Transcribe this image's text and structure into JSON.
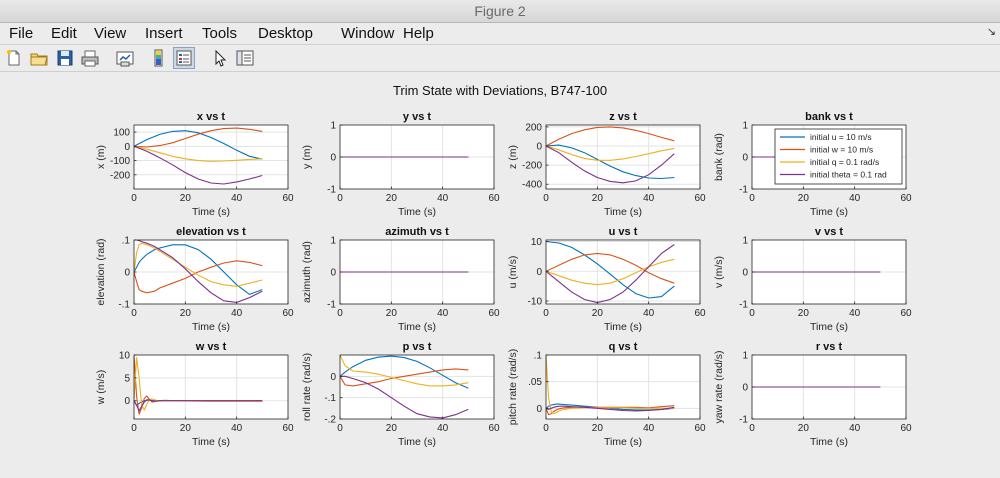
{
  "window": {
    "title": "Figure 2"
  },
  "menu": [
    "File",
    "Edit",
    "View",
    "Insert",
    "Tools",
    "Desktop",
    "Window",
    "Help"
  ],
  "toolbar": [
    {
      "name": "new-figure-icon"
    },
    {
      "name": "open-file-icon"
    },
    {
      "name": "save-icon"
    },
    {
      "name": "print-icon"
    },
    {
      "name": "link-plot-icon"
    },
    {
      "name": "colorbar-icon"
    },
    {
      "name": "legend-icon",
      "selected": true
    },
    {
      "name": "edit-plot-icon"
    },
    {
      "name": "plot-tools-icon"
    }
  ],
  "figure": {
    "suptitle": "Trim State with Deviations, B747-100"
  },
  "colors": {
    "u": "#0072BD",
    "w": "#D95319",
    "q": "#EDB120",
    "theta": "#7E2F8E",
    "bg": "#ececec",
    "axes": "#ffffff"
  },
  "legend": {
    "entries": [
      "initial u = 10 m/s",
      "initial w = 10 m/s",
      "initial q = 0.1 rad/s",
      "initial theta = 0.1 rad"
    ],
    "panel": "bank vs t",
    "placement": "top-right"
  },
  "chart_data": [
    {
      "type": "line",
      "title": "x vs t",
      "xlabel": "Time (s)",
      "ylabel": "x (m)",
      "xlim": [
        0,
        60
      ],
      "ylim": [
        -300,
        150
      ],
      "xticks": [
        0,
        20,
        40,
        60
      ],
      "yticks": [
        100,
        0,
        -100,
        -200
      ],
      "x": [
        0,
        5,
        10,
        15,
        20,
        25,
        30,
        35,
        40,
        45,
        50
      ],
      "series": [
        {
          "name": "initial u = 10 m/s",
          "values": [
            0,
            47,
            84,
            105,
            110,
            95,
            62,
            20,
            -28,
            -70,
            -90
          ]
        },
        {
          "name": "initial w = 10 m/s",
          "values": [
            0,
            -5,
            5,
            25,
            55,
            85,
            110,
            125,
            128,
            120,
            105
          ]
        },
        {
          "name": "initial q = 0.1 rad/s",
          "values": [
            0,
            -20,
            -45,
            -70,
            -88,
            -100,
            -105,
            -103,
            -98,
            -92,
            -88
          ]
        },
        {
          "name": "initial theta = 0.1 rad",
          "values": [
            0,
            -35,
            -80,
            -130,
            -185,
            -230,
            -258,
            -265,
            -250,
            -230,
            -205
          ]
        }
      ]
    },
    {
      "type": "line",
      "title": "y vs t",
      "xlabel": "Time (s)",
      "ylabel": "y (m)",
      "xlim": [
        0,
        60
      ],
      "ylim": [
        -1,
        1
      ],
      "xticks": [
        0,
        20,
        40,
        60
      ],
      "yticks": [
        1,
        0,
        -1
      ],
      "x": [
        0,
        50
      ],
      "series": [
        {
          "name": "initial u = 10 m/s",
          "values": [
            0,
            0
          ]
        },
        {
          "name": "initial w = 10 m/s",
          "values": [
            0,
            0
          ]
        },
        {
          "name": "initial q = 0.1 rad/s",
          "values": [
            0,
            0
          ]
        },
        {
          "name": "initial theta = 0.1 rad",
          "values": [
            0,
            0
          ]
        }
      ]
    },
    {
      "type": "line",
      "title": "z vs t",
      "xlabel": "Time (s)",
      "ylabel": "z (m)",
      "xlim": [
        0,
        60
      ],
      "ylim": [
        -450,
        220
      ],
      "xticks": [
        0,
        20,
        40,
        60
      ],
      "yticks": [
        200,
        0,
        -200,
        -400
      ],
      "x": [
        0,
        5,
        10,
        15,
        20,
        25,
        30,
        35,
        40,
        45,
        50
      ],
      "series": [
        {
          "name": "initial u = 10 m/s",
          "values": [
            0,
            10,
            -20,
            -70,
            -140,
            -210,
            -270,
            -310,
            -335,
            -340,
            -330
          ]
        },
        {
          "name": "initial w = 10 m/s",
          "values": [
            0,
            70,
            130,
            170,
            195,
            200,
            190,
            165,
            130,
            90,
            55
          ]
        },
        {
          "name": "initial q = 0.1 rad/s",
          "values": [
            0,
            -40,
            -90,
            -130,
            -150,
            -150,
            -135,
            -110,
            -80,
            -50,
            -25
          ]
        },
        {
          "name": "initial theta = 0.1 rad",
          "values": [
            0,
            -70,
            -170,
            -260,
            -330,
            -370,
            -385,
            -365,
            -300,
            -200,
            -80
          ]
        }
      ]
    },
    {
      "type": "line",
      "title": "bank vs t",
      "xlabel": "Time (s)",
      "ylabel": "bank (rad)",
      "xlim": [
        0,
        60
      ],
      "ylim": [
        -1,
        1
      ],
      "xticks": [
        0,
        20,
        40,
        60
      ],
      "yticks": [
        1,
        0,
        -1
      ],
      "x": [
        0,
        50
      ],
      "series": [
        {
          "name": "initial u = 10 m/s",
          "values": [
            0,
            0
          ]
        },
        {
          "name": "initial w = 10 m/s",
          "values": [
            0,
            0
          ]
        },
        {
          "name": "initial q = 0.1 rad/s",
          "values": [
            0,
            0
          ]
        },
        {
          "name": "initial theta = 0.1 rad",
          "values": [
            0,
            0
          ]
        }
      ]
    },
    {
      "type": "line",
      "title": "elevation vs t",
      "xlabel": "Time (s)",
      "ylabel": "elevation (rad)",
      "xlim": [
        0,
        60
      ],
      "ylim": [
        -0.1,
        0.1
      ],
      "xticks": [
        0,
        20,
        40,
        60
      ],
      "yticks": [
        0.1,
        0,
        -0.1
      ],
      "x": [
        0,
        1,
        2,
        3,
        5,
        8,
        10,
        15,
        20,
        25,
        30,
        35,
        40,
        45,
        50
      ],
      "series": [
        {
          "name": "initial u = 10 m/s",
          "values": [
            0,
            0.015,
            0.03,
            0.04,
            0.055,
            0.07,
            0.075,
            0.085,
            0.085,
            0.07,
            0.04,
            0,
            -0.04,
            -0.07,
            -0.055
          ]
        },
        {
          "name": "initial w = 10 m/s",
          "values": [
            0,
            -0.03,
            -0.055,
            -0.06,
            -0.065,
            -0.06,
            -0.05,
            -0.035,
            -0.02,
            0,
            0.015,
            0.028,
            0.035,
            0.03,
            0.02
          ]
        },
        {
          "name": "initial q = 0.1 rad/s",
          "values": [
            0,
            0.06,
            0.085,
            0.09,
            0.085,
            0.075,
            0.065,
            0.04,
            0.015,
            -0.01,
            -0.03,
            -0.04,
            -0.045,
            -0.035,
            -0.025
          ]
        },
        {
          "name": "initial theta = 0.1 rad",
          "values": [
            0.1,
            0.1,
            0.098,
            0.095,
            0.09,
            0.08,
            0.07,
            0.045,
            0.01,
            -0.03,
            -0.065,
            -0.09,
            -0.095,
            -0.08,
            -0.06
          ]
        }
      ]
    },
    {
      "type": "line",
      "title": "azimuth vs t",
      "xlabel": "Time (s)",
      "ylabel": "azimuth (rad)",
      "xlim": [
        0,
        60
      ],
      "ylim": [
        -1,
        1
      ],
      "xticks": [
        0,
        20,
        40,
        60
      ],
      "yticks": [
        1,
        0,
        -1
      ],
      "x": [
        0,
        50
      ],
      "series": [
        {
          "name": "initial u = 10 m/s",
          "values": [
            0,
            0
          ]
        },
        {
          "name": "initial w = 10 m/s",
          "values": [
            0,
            0
          ]
        },
        {
          "name": "initial q = 0.1 rad/s",
          "values": [
            0,
            0
          ]
        },
        {
          "name": "initial theta = 0.1 rad",
          "values": [
            0,
            0
          ]
        }
      ]
    },
    {
      "type": "line",
      "title": "u vs t",
      "xlabel": "Time (s)",
      "ylabel": "u (m/s)",
      "xlim": [
        0,
        60
      ],
      "ylim": [
        -11,
        10.5
      ],
      "xticks": [
        0,
        20,
        40,
        60
      ],
      "yticks": [
        10,
        0,
        -10
      ],
      "x": [
        0,
        5,
        10,
        15,
        20,
        25,
        30,
        35,
        40,
        45,
        50
      ],
      "series": [
        {
          "name": "initial u = 10 m/s",
          "values": [
            10,
            9.5,
            8,
            5.5,
            2.5,
            -1,
            -4.5,
            -7.5,
            -9,
            -8.5,
            -5
          ]
        },
        {
          "name": "initial w = 10 m/s",
          "values": [
            0,
            2,
            4,
            5.5,
            6,
            5.5,
            4,
            2,
            -0.5,
            -2.5,
            -4
          ]
        },
        {
          "name": "initial q = 0.1 rad/s",
          "values": [
            0,
            -1.5,
            -3,
            -4,
            -4.5,
            -4,
            -2.5,
            -0.5,
            1.5,
            3,
            4
          ]
        },
        {
          "name": "initial theta = 0.1 rad",
          "values": [
            0,
            -3.5,
            -7,
            -9.5,
            -10.5,
            -9.5,
            -7,
            -3,
            1.5,
            6,
            9
          ]
        }
      ]
    },
    {
      "type": "line",
      "title": "v vs t",
      "xlabel": "Time (s)",
      "ylabel": "v (m/s)",
      "xlim": [
        0,
        60
      ],
      "ylim": [
        -1,
        1
      ],
      "xticks": [
        0,
        20,
        40,
        60
      ],
      "yticks": [
        1,
        0,
        -1
      ],
      "x": [
        0,
        50
      ],
      "series": [
        {
          "name": "initial u = 10 m/s",
          "values": [
            0,
            0
          ]
        },
        {
          "name": "initial w = 10 m/s",
          "values": [
            0,
            0
          ]
        },
        {
          "name": "initial q = 0.1 rad/s",
          "values": [
            0,
            0
          ]
        },
        {
          "name": "initial theta = 0.1 rad",
          "values": [
            0,
            0
          ]
        }
      ]
    },
    {
      "type": "line",
      "title": "w vs t",
      "xlabel": "Time (s)",
      "ylabel": "w (m/s)",
      "xlim": [
        0,
        60
      ],
      "ylim": [
        -4,
        10
      ],
      "xticks": [
        0,
        20,
        40,
        60
      ],
      "yticks": [
        10,
        5,
        0
      ],
      "x": [
        0,
        1,
        2,
        3,
        4,
        5,
        6,
        7,
        8,
        10,
        12,
        15,
        20,
        30,
        40,
        50
      ],
      "series": [
        {
          "name": "initial u = 10 m/s",
          "values": [
            0,
            -1,
            -0.6,
            -0.2,
            0,
            0.1,
            0.1,
            0,
            0,
            0,
            0,
            0,
            0,
            -0.05,
            -0.05,
            0
          ]
        },
        {
          "name": "initial w = 10 m/s",
          "values": [
            10,
            1,
            -3,
            -1.5,
            0.5,
            1,
            0.3,
            -0.3,
            -0.2,
            0,
            0.1,
            0,
            -0.05,
            -0.1,
            -0.1,
            -0.1
          ]
        },
        {
          "name": "initial q = 0.1 rad/s",
          "values": [
            0,
            9.5,
            5,
            -1,
            -2,
            -0.8,
            0.2,
            0.4,
            0.2,
            -0.1,
            0,
            0,
            0,
            0,
            0,
            0
          ]
        },
        {
          "name": "initial theta = 0.1 rad",
          "values": [
            0,
            -1,
            -2.2,
            -1.2,
            -0.3,
            0.2,
            0.2,
            0,
            -0.1,
            0,
            0,
            0,
            0,
            0,
            0,
            0
          ]
        }
      ]
    },
    {
      "type": "line",
      "title": "p vs t",
      "xlabel": "Time (s)",
      "ylabel": "roll rate (rad/s)",
      "xlim": [
        0,
        60
      ],
      "ylim": [
        -0.2,
        0.1
      ],
      "xticks": [
        0,
        20,
        40,
        60
      ],
      "yticks": [
        0,
        -0.1,
        -0.2
      ],
      "x": [
        0,
        2,
        5,
        10,
        15,
        20,
        25,
        30,
        35,
        40,
        45,
        50
      ],
      "series": [
        {
          "name": "initial u = 10 m/s",
          "values": [
            0,
            0.02,
            0.045,
            0.075,
            0.09,
            0.095,
            0.088,
            0.07,
            0.04,
            0.005,
            -0.03,
            -0.055
          ]
        },
        {
          "name": "initial w = 10 m/s",
          "values": [
            0,
            -0.04,
            -0.045,
            -0.035,
            -0.025,
            -0.01,
            0,
            0.01,
            0.02,
            0.03,
            0.035,
            0.03
          ]
        },
        {
          "name": "initial q = 0.1 rad/s",
          "values": [
            0.1,
            0.05,
            0.025,
            0.02,
            0.01,
            -0.005,
            -0.02,
            -0.035,
            -0.045,
            -0.045,
            -0.04,
            -0.03
          ]
        },
        {
          "name": "initial theta = 0.1 rad",
          "values": [
            0,
            0,
            -0.01,
            -0.03,
            -0.06,
            -0.1,
            -0.14,
            -0.175,
            -0.19,
            -0.195,
            -0.18,
            -0.155
          ]
        }
      ]
    },
    {
      "type": "line",
      "title": "q vs t",
      "xlabel": "Time (s)",
      "ylabel": "pitch rate (rad/s)",
      "xlim": [
        0,
        60
      ],
      "ylim": [
        -0.02,
        0.1
      ],
      "xticks": [
        0,
        20,
        40,
        60
      ],
      "yticks": [
        0.1,
        0.05,
        0
      ],
      "x": [
        0,
        1,
        2,
        3,
        4,
        5,
        7,
        10,
        15,
        20,
        25,
        30,
        35,
        40,
        45,
        50
      ],
      "series": [
        {
          "name": "initial u = 10 m/s",
          "values": [
            0,
            0.004,
            0.006,
            0.007,
            0.008,
            0.008,
            0.007,
            0.006,
            0.004,
            0.002,
            0,
            -0.002,
            -0.003,
            -0.003,
            -0.002,
            0
          ]
        },
        {
          "name": "initial w = 10 m/s",
          "values": [
            0,
            -0.012,
            -0.01,
            -0.006,
            -0.003,
            -0.001,
            0.001,
            0.002,
            0.002,
            0.002,
            0.002,
            0.002,
            0.002,
            0.001,
            0.003,
            0.005
          ]
        },
        {
          "name": "initial q = 0.1 rad/s",
          "values": [
            0.1,
            0.02,
            -0.006,
            -0.01,
            -0.008,
            -0.005,
            -0.002,
            0,
            0.001,
            0.001,
            0.001,
            0.001,
            0,
            0,
            0,
            0
          ]
        },
        {
          "name": "initial theta = 0.1 rad",
          "values": [
            0,
            -0.002,
            0,
            0.002,
            0.003,
            0.004,
            0.004,
            0.003,
            0.002,
            0,
            -0.002,
            -0.004,
            -0.005,
            -0.004,
            -0.002,
            0.002
          ]
        }
      ]
    },
    {
      "type": "line",
      "title": "r vs t",
      "xlabel": "Time (s)",
      "ylabel": "yaw rate (rad/s)",
      "xlim": [
        0,
        60
      ],
      "ylim": [
        -1,
        1
      ],
      "xticks": [
        0,
        20,
        40,
        60
      ],
      "yticks": [
        1,
        0,
        -1
      ],
      "x": [
        0,
        50
      ],
      "series": [
        {
          "name": "initial u = 10 m/s",
          "values": [
            0,
            0
          ]
        },
        {
          "name": "initial w = 10 m/s",
          "values": [
            0,
            0
          ]
        },
        {
          "name": "initial q = 0.1 rad/s",
          "values": [
            0,
            0
          ]
        },
        {
          "name": "initial theta = 0.1 rad",
          "values": [
            0,
            0
          ]
        }
      ]
    }
  ]
}
